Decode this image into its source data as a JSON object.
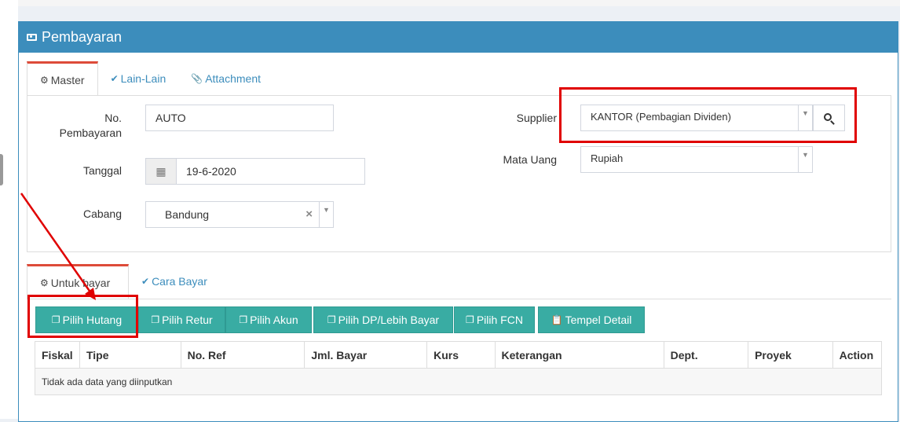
{
  "panel": {
    "title": "Pembayaran",
    "icon": "money-icon"
  },
  "master_tabs": [
    {
      "label": "Master",
      "icon": "cogs-icon",
      "active": true
    },
    {
      "label": "Lain-Lain",
      "icon": "check-circle-icon",
      "active": false
    },
    {
      "label": "Attachment",
      "icon": "paperclip-icon",
      "active": false
    }
  ],
  "form": {
    "no_pembayaran_label": "No. Pembayaran",
    "no_pembayaran_value": "AUTO",
    "tanggal_label": "Tanggal",
    "tanggal_value": "19-6-2020",
    "cabang_label": "Cabang",
    "cabang_value": "Bandung",
    "supplier_label": "Supplier",
    "supplier_value": "KANTOR (Pembagian Dividen)",
    "mata_uang_label": "Mata Uang",
    "mata_uang_value": "Rupiah"
  },
  "detail_tabs": [
    {
      "label": "Untuk bayar",
      "icon": "cogs-icon",
      "active": true
    },
    {
      "label": "Cara Bayar",
      "icon": "check-circle-icon",
      "active": false
    }
  ],
  "buttons": [
    {
      "label": "Pilih Hutang",
      "icon": "copy-icon"
    },
    {
      "label": "Pilih Retur",
      "icon": "copy-icon"
    },
    {
      "label": "Pilih Akun",
      "icon": "copy-icon"
    },
    {
      "label": "Pilih DP/Lebih Bayar",
      "icon": "copy-icon"
    },
    {
      "label": "Pilih FCN",
      "icon": "copy-icon"
    },
    {
      "label": "Tempel Detail",
      "icon": "paste-icon"
    }
  ],
  "table": {
    "columns": [
      "Fiskal",
      "Tipe",
      "No. Ref",
      "Jml. Bayar",
      "Kurs",
      "Keterangan",
      "Dept.",
      "Proyek",
      "Action"
    ],
    "empty_message": "Tidak ada data yang diinputkan"
  },
  "colors": {
    "header": "#3c8dbc",
    "button": "#39aca3",
    "annotation": "#e00000",
    "active_tab_border": "#dd4b39"
  }
}
